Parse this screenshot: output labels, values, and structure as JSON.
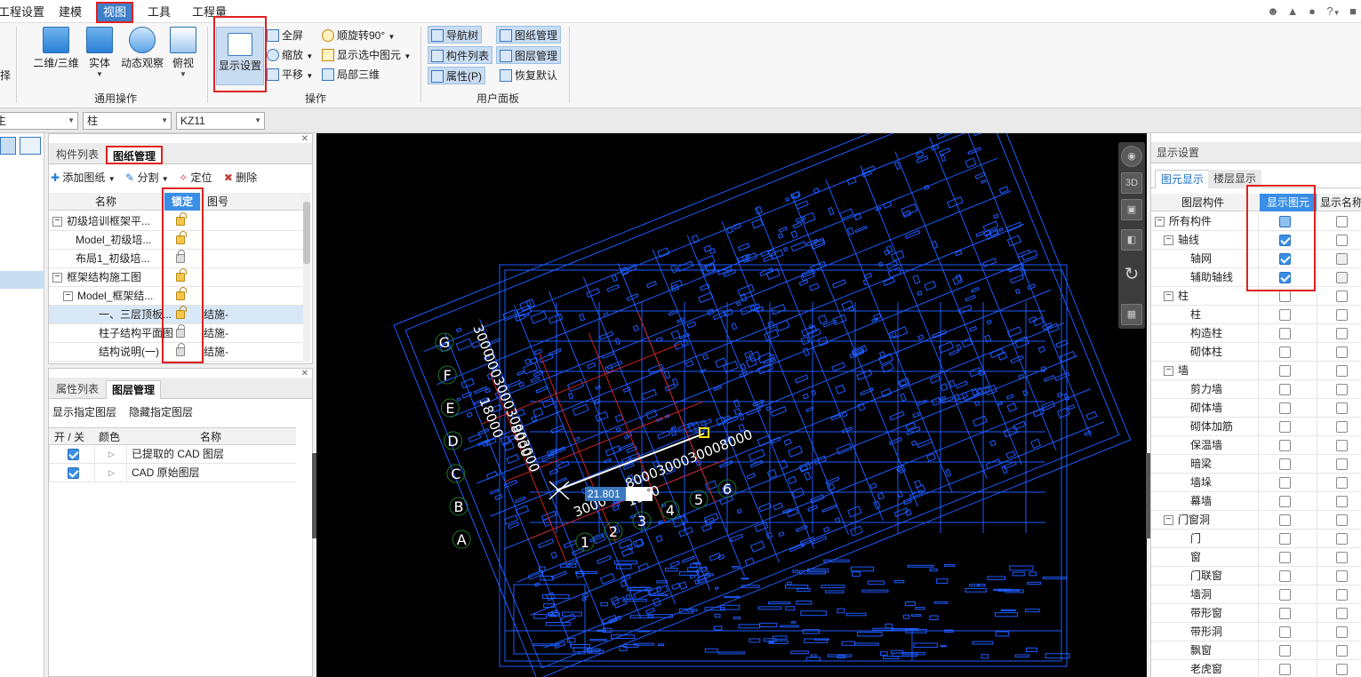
{
  "menubar": {
    "tabs": [
      {
        "label": "工程设置"
      },
      {
        "label": "建模"
      },
      {
        "label": "视图"
      },
      {
        "label": "工具"
      },
      {
        "label": "工程量"
      }
    ],
    "active_tab": "视图",
    "right_icons": [
      "user-icon",
      "bell-icon",
      "chat-icon",
      "help-icon",
      "shirt-icon"
    ],
    "help_text": "?"
  },
  "ribbon": {
    "cut_label": "择",
    "common_ops": {
      "group_label": "通用操作",
      "buttons": [
        {
          "label": "二维/三维",
          "icon": "3d-box-icon"
        },
        {
          "label": "实体",
          "icon": "solid-icon"
        },
        {
          "label": "动态观察",
          "icon": "orbit-icon"
        },
        {
          "label": "俯视",
          "icon": "top-view-icon"
        }
      ]
    },
    "ops": {
      "group_label": "操作",
      "display_settings": "显示设置",
      "small": [
        {
          "label": "全屏",
          "has_dropdown": false
        },
        {
          "label": "缩放",
          "has_dropdown": true
        },
        {
          "label": "平移",
          "has_dropdown": true
        },
        {
          "label": "顺旋转90°",
          "has_dropdown": true
        },
        {
          "label": "显示选中图元",
          "has_dropdown": true
        },
        {
          "label": "局部三维",
          "has_dropdown": false
        }
      ]
    },
    "user_panel": {
      "group_label": "用户面板",
      "items": [
        {
          "label": "导航树",
          "selected": true
        },
        {
          "label": "图纸管理",
          "selected": true
        },
        {
          "label": "构件列表",
          "selected": true
        },
        {
          "label": "图层管理",
          "selected": true
        },
        {
          "label": "属性(P)",
          "selected": true
        },
        {
          "label": "恢复默认",
          "selected": false
        }
      ]
    }
  },
  "combobar": {
    "combo1": "主",
    "combo2": "柱",
    "combo3": "KZ11"
  },
  "drawing_panel": {
    "tabs": [
      "构件列表",
      "图纸管理"
    ],
    "active_tab": "图纸管理",
    "toolbar": {
      "add": "添加图纸",
      "split": "分割",
      "locate": "定位",
      "delete": "删除"
    },
    "columns": {
      "name": "名称",
      "lock": "锁定",
      "num": "图号"
    },
    "rows": [
      {
        "name": "初级培训框架平...",
        "indent": 0,
        "expander": "−",
        "lock": "open",
        "num": ""
      },
      {
        "name": "Model_初级培...",
        "indent": 1,
        "expander": "",
        "lock": "open",
        "num": ""
      },
      {
        "name": "布局1_初级培...",
        "indent": 1,
        "expander": "",
        "lock": "closed",
        "num": ""
      },
      {
        "name": "框架结构施工图",
        "indent": 0,
        "expander": "−",
        "lock": "open",
        "num": ""
      },
      {
        "name": "Model_框架结...",
        "indent": 1,
        "expander": "−",
        "lock": "open",
        "num": ""
      },
      {
        "name": "一、三层顶板...",
        "indent": 2,
        "expander": "",
        "lock": "open",
        "num": "结施-",
        "selected": true
      },
      {
        "name": "柱子结构平面图",
        "indent": 2,
        "expander": "",
        "lock": "closed",
        "num": "结施-"
      },
      {
        "name": "结构说明(一)",
        "indent": 2,
        "expander": "",
        "lock": "closed",
        "num": "结施-"
      }
    ]
  },
  "layer_panel": {
    "tabs": [
      "属性列表",
      "图层管理"
    ],
    "active_tab": "图层管理",
    "actions": {
      "show": "显示指定图层",
      "hide": "隐藏指定图层"
    },
    "columns": {
      "onoff": "开 / 关",
      "color": "颜色",
      "name": "名称"
    },
    "rows": [
      {
        "on": true,
        "name": "已提取的 CAD 图层"
      },
      {
        "on": true,
        "name": "CAD 原始图层"
      }
    ]
  },
  "canvas": {
    "input_value": "21.801",
    "degree_symbol": "°",
    "axis_letters": [
      "G",
      "F",
      "E",
      "D",
      "C",
      "B",
      "A"
    ],
    "axis_numbers": [
      "1",
      "2",
      "3",
      "4",
      "5",
      "6"
    ],
    "dim_top_left": "3000",
    "dim_18000": "18000",
    "dim_3000_bottom": "3000",
    "dim_1500": "1500",
    "dim_8000": "8000",
    "dim_repeat": "000300030003000",
    "dim_repeat2": "8000300030008000",
    "dim_diag": "300030008000",
    "colors": {
      "bg": "#000000",
      "cad_blue": "#1e5cff",
      "cad_red": "#d02020",
      "circle_green": "#1f7a2a"
    }
  },
  "nav3d": {
    "buttons": [
      "globe-icon",
      "3d-cube-icon",
      "cube-front-icon",
      "cube-corner-icon",
      "rotate-icon",
      "grid-icon"
    ],
    "cube_label": "3D"
  },
  "display_settings": {
    "title": "显示设置",
    "tabs": [
      "图元显示",
      "楼层显示"
    ],
    "active_tab": "图元显示",
    "columns": {
      "component": "图层构件",
      "show": "显示图元",
      "showname": "显示名称"
    },
    "rows": [
      {
        "label": "所有构件",
        "level": 0,
        "expander": "−",
        "show": "part",
        "name": false
      },
      {
        "label": "轴线",
        "level": 1,
        "expander": "−",
        "show": "on",
        "name": false
      },
      {
        "label": "轴网",
        "level": 2,
        "show": "on",
        "name": false
      },
      {
        "label": "辅助轴线",
        "level": 2,
        "show": "on",
        "name": false
      },
      {
        "label": "柱",
        "level": 1,
        "expander": "−",
        "show": "off",
        "name": false
      },
      {
        "label": "柱",
        "level": 2,
        "show": "off",
        "name": false
      },
      {
        "label": "构造柱",
        "level": 2,
        "show": "off",
        "name": false
      },
      {
        "label": "砌体柱",
        "level": 2,
        "show": "off",
        "name": false
      },
      {
        "label": "墙",
        "level": 1,
        "expander": "−",
        "show": "off",
        "name": false
      },
      {
        "label": "剪力墙",
        "level": 2,
        "show": "off",
        "name": false
      },
      {
        "label": "砌体墙",
        "level": 2,
        "show": "off",
        "name": false
      },
      {
        "label": "砌体加筋",
        "level": 2,
        "show": "off",
        "name": false
      },
      {
        "label": "保温墙",
        "level": 2,
        "show": "off",
        "name": false
      },
      {
        "label": "暗梁",
        "level": 2,
        "show": "off",
        "name": false
      },
      {
        "label": "墙垛",
        "level": 2,
        "show": "off",
        "name": false
      },
      {
        "label": "幕墙",
        "level": 2,
        "show": "off",
        "name": false
      },
      {
        "label": "门窗洞",
        "level": 1,
        "expander": "−",
        "show": "off",
        "name": false
      },
      {
        "label": "门",
        "level": 2,
        "show": "off",
        "name": false
      },
      {
        "label": "窗",
        "level": 2,
        "show": "off",
        "name": false
      },
      {
        "label": "门联窗",
        "level": 2,
        "show": "off",
        "name": false
      },
      {
        "label": "墙洞",
        "level": 2,
        "show": "off",
        "name": false
      },
      {
        "label": "带形窗",
        "level": 2,
        "show": "off",
        "name": false
      },
      {
        "label": "带形洞",
        "level": 2,
        "show": "off",
        "name": false
      },
      {
        "label": "飘窗",
        "level": 2,
        "show": "off",
        "name": false
      },
      {
        "label": "老虎窗",
        "level": 2,
        "show": "off",
        "name": false
      }
    ]
  }
}
